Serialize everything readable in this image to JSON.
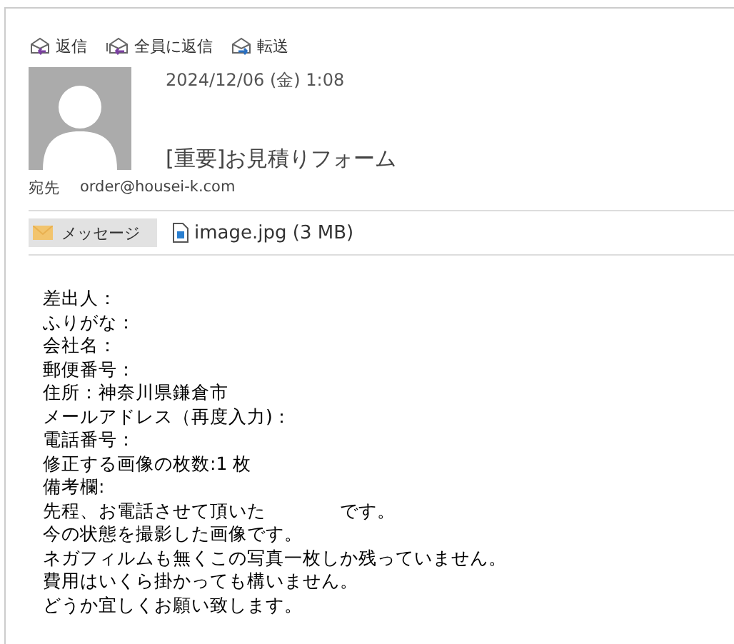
{
  "toolbar": [
    {
      "kind": "reply",
      "label": "返信"
    },
    {
      "kind": "reply_all",
      "label": "全員に返信"
    },
    {
      "kind": "forward",
      "label": "転送"
    }
  ],
  "header": {
    "date": "2024/12/06 (金) 1:08",
    "subject": "[重要]お見積りフォーム",
    "to_label": "宛先",
    "to": "order@housei-k.com"
  },
  "attachments": [
    {
      "kind": "message",
      "label": "メッセージ",
      "selected": true
    },
    {
      "kind": "file",
      "label": "image.jpg (3 MB)",
      "selected": false
    }
  ],
  "body": [
    "差出人：",
    "ふりがな：",
    "会社名：",
    "郵便番号：",
    "住所：神奈川県鎌倉市",
    "メールアドレス（再度入力)：",
    "電話番号：",
    "修正する画像の枚数:1 枚",
    "備考欄:",
    "先程、お電話させて頂いた　　　　です。",
    "今の状態を撮影した画像です。",
    "ネガフィルムも無くこの写真一枚しか残っていません。",
    "費用はいくら掛かっても構いません。",
    "どうか宜しくお願い致します。"
  ]
}
